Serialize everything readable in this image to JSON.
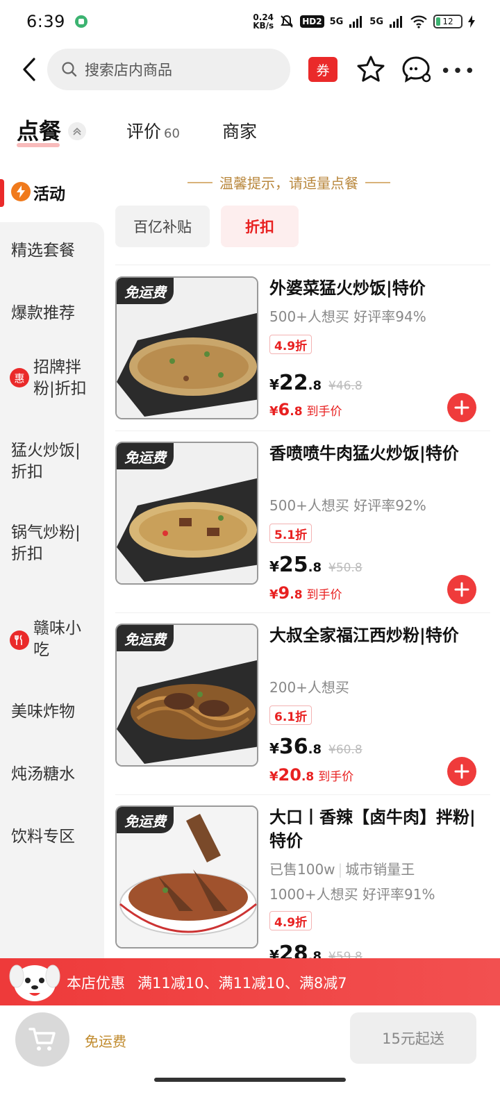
{
  "status": {
    "time": "6:39",
    "net_speed_top": "0.24",
    "net_speed_bottom": "KB/s",
    "hd": "HD2",
    "sig1": "5G",
    "sig2": "5G",
    "battery": "12"
  },
  "search": {
    "placeholder": "搜索店内商品"
  },
  "header": {
    "coupon_label": "券"
  },
  "tabs": {
    "order": "点餐",
    "review": "评价",
    "review_count": "60",
    "merchant": "商家"
  },
  "sidebar": {
    "active": "活动",
    "items": [
      "精选套餐",
      "爆款推荐",
      "招牌拌粉|折扣",
      "猛火炒饭|折扣",
      "锅气炒粉|折扣",
      "赣味小吃",
      "美味炸物",
      "炖汤糖水",
      "饮料专区"
    ],
    "badge_hui": "惠"
  },
  "tip": "温馨提示，请适量点餐",
  "chips": [
    "百亿补贴",
    "折扣"
  ],
  "free_ship_tag": "免运费",
  "products": [
    {
      "title": "外婆菜猛火炒饭|特价",
      "sub": "500+人想买  好评率94%",
      "discount": "4.9折",
      "price_int": "22",
      "price_dec": ".8",
      "old_price": "¥46.8",
      "final_int": "6",
      "final_dec": ".8",
      "final_label": "到手价"
    },
    {
      "title": "香喷喷牛肉猛火炒饭|特价",
      "sub": "500+人想买  好评率92%",
      "discount": "5.1折",
      "price_int": "25",
      "price_dec": ".8",
      "old_price": "¥50.8",
      "final_int": "9",
      "final_dec": ".8",
      "final_label": "到手价"
    },
    {
      "title": "大叔全家福江西炒粉|特价",
      "sub": "200+人想买",
      "discount": "6.1折",
      "price_int": "36",
      "price_dec": ".8",
      "old_price": "¥60.8",
      "final_int": "20",
      "final_dec": ".8",
      "final_label": "到手价"
    },
    {
      "title": "大口丨香辣【卤牛肉】拌粉|特价",
      "tag1": "已售100w",
      "tag2": "城市销量王",
      "sub": "1000+人想买  好评率91%",
      "discount": "4.9折",
      "price_int": "28",
      "price_dec": ".8",
      "old_price": "¥59.8"
    }
  ],
  "currency": "¥",
  "promo": {
    "label": "本店优惠",
    "text": "满11减10、满11减10、满8减7"
  },
  "bottom": {
    "free_shipping": "免运费",
    "min_order": "15元起送"
  },
  "colors": {
    "accent": "#ea2a2a",
    "gold": "#b8863b"
  },
  "icons": [
    "back-icon",
    "search-icon",
    "star-icon",
    "chat-icon",
    "more-icon",
    "cart-icon",
    "plus-icon",
    "lightning-icon",
    "utensils-icon"
  ]
}
